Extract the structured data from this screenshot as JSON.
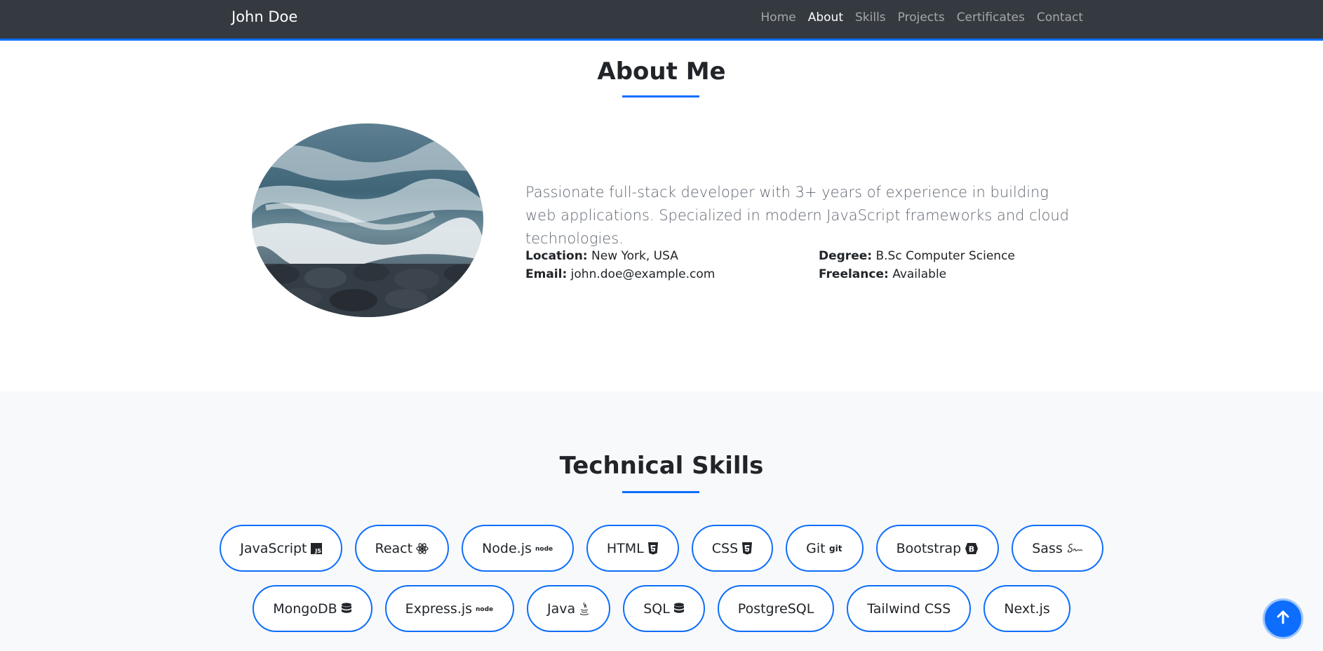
{
  "nav": {
    "brand": "John Doe",
    "links": [
      {
        "label": "Home"
      },
      {
        "label": "About",
        "active": true
      },
      {
        "label": "Skills"
      },
      {
        "label": "Projects"
      },
      {
        "label": "Certificates"
      },
      {
        "label": "Contact"
      }
    ]
  },
  "about": {
    "title": "About Me",
    "bio": "Passionate full-stack developer with 3+ years of experience in building web applications. Specialized in modern JavaScript frameworks and cloud technologies.",
    "location_label": "Location:",
    "location": "New York, USA",
    "email_label": "Email:",
    "email": "john.doe@example.com",
    "degree_label": "Degree:",
    "degree": "B.Sc Computer Science",
    "freelance_label": "Freelance:",
    "freelance": "Available"
  },
  "skills": {
    "title": "Technical Skills",
    "row1": [
      {
        "label": "JavaScript",
        "icon": "js-icon"
      },
      {
        "label": "React",
        "icon": "react-icon"
      },
      {
        "label": "Node.js",
        "icon": "node-icon"
      },
      {
        "label": "HTML",
        "icon": "html5-icon"
      },
      {
        "label": "CSS",
        "icon": "css3-icon"
      },
      {
        "label": "Git",
        "icon": "git-icon"
      },
      {
        "label": "Bootstrap",
        "icon": "bootstrap-icon"
      },
      {
        "label": "Sass",
        "icon": "sass-icon"
      }
    ],
    "row2": [
      {
        "label": "MongoDB",
        "icon": "database-icon"
      },
      {
        "label": "Express.js",
        "icon": "node-icon"
      },
      {
        "label": "Java",
        "icon": "java-icon"
      },
      {
        "label": "SQL",
        "icon": "database-icon"
      },
      {
        "label": "PostgreSQL",
        "icon": ""
      },
      {
        "label": "Tailwind CSS",
        "icon": ""
      },
      {
        "label": "Next.js",
        "icon": ""
      }
    ]
  },
  "back_to_top": {
    "icon": "arrow-up-icon"
  },
  "colors": {
    "accent": "#0d6efd",
    "navbar": "#343a40",
    "skills_bg": "#f8f9fa"
  }
}
